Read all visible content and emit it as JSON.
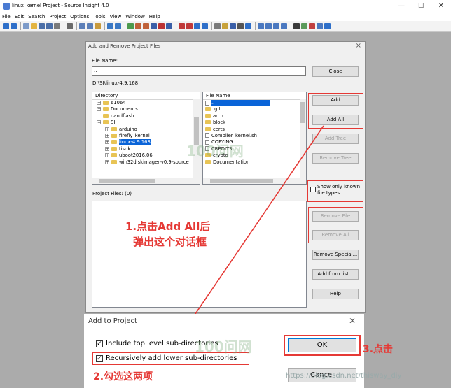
{
  "window": {
    "title": "linux_kernel Project - Source Insight 4.0",
    "min": "—",
    "max": "☐",
    "close": "✕"
  },
  "menu": [
    "File",
    "Edit",
    "Search",
    "Project",
    "Options",
    "Tools",
    "View",
    "Window",
    "Help"
  ],
  "dialog1": {
    "title": "Add and Remove Project Files",
    "file_name_label": "File Name:",
    "file_name_value": "..",
    "path": "D:\\SI\\linux-4.9.168",
    "directory_header": "Directory",
    "file_name_header": "File Name",
    "directories": [
      {
        "name": "61064",
        "indent": 1,
        "expander": "+"
      },
      {
        "name": "Documents",
        "indent": 1,
        "expander": "+"
      },
      {
        "name": "nandflash",
        "indent": 1,
        "expander": ""
      },
      {
        "name": "SI",
        "indent": 1,
        "expander": "−"
      },
      {
        "name": "arduino",
        "indent": 2,
        "expander": "+"
      },
      {
        "name": "firefly_kernel",
        "indent": 2,
        "expander": "+"
      },
      {
        "name": "linux-4.9.168",
        "indent": 2,
        "expander": "+",
        "selected": true
      },
      {
        "name": "tisdk",
        "indent": 2,
        "expander": "+"
      },
      {
        "name": "uboot2016.06",
        "indent": 2,
        "expander": "+"
      },
      {
        "name": "win32diskimager-v0.9-source",
        "indent": 2,
        "expander": "+"
      }
    ],
    "files": [
      {
        "name": "..",
        "type": "file",
        "selected": true
      },
      {
        "name": ".git",
        "type": "folder"
      },
      {
        "name": "arch",
        "type": "folder"
      },
      {
        "name": "block",
        "type": "folder"
      },
      {
        "name": "certs",
        "type": "folder"
      },
      {
        "name": "Compiler_kernel.sh",
        "type": "file"
      },
      {
        "name": "COPYING",
        "type": "file"
      },
      {
        "name": "CREDITS",
        "type": "file"
      },
      {
        "name": "crypto",
        "type": "folder"
      },
      {
        "name": "Documentation",
        "type": "folder"
      }
    ],
    "project_files_label": "Project Files: (0)",
    "buttons": {
      "close": "Close",
      "add": "Add",
      "add_all": "Add All",
      "add_tree": "Add Tree",
      "remove_tree": "Remove Tree",
      "remove_file": "Remove File",
      "remove_all": "Remove All",
      "remove_special": "Remove Special...",
      "add_from_list": "Add from list...",
      "help": "Help"
    },
    "show_only_known": "Show only known file types"
  },
  "dialog2": {
    "title": "Add to Project",
    "option1": "Include top level sub-directories",
    "option2": "Recursively add lower sub-directories",
    "option1_checked": true,
    "option2_checked": true,
    "ok": "OK",
    "cancel": "Cancel"
  },
  "annotations": {
    "step1_line1": "1.点击Add All后",
    "step1_line2": "弹出这个对话框",
    "step2": "2.勾选这两项",
    "step3": "3.点击",
    "watermark_url": "https://blog.csdn.net/thisway_diy"
  },
  "colors": {
    "annotation_red": "#e53935",
    "selection_blue": "#0a64d8"
  }
}
